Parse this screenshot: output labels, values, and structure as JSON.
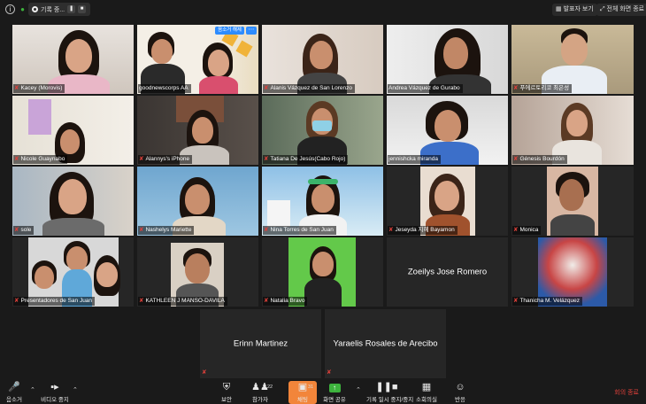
{
  "top_bar": {
    "recording_label": "기록 중...",
    "speaker_view_label": "발표자 보기",
    "fullscreen_exit_label": "전체 화면 종료"
  },
  "tiles": [
    {
      "name": "Kacey (Morovis)",
      "muted": true
    },
    {
      "name": "goodnewscorps AA",
      "muted": false,
      "unmute_label": "음소거 해제"
    },
    {
      "name": "Alanis Vázquez de San Lorenzo",
      "muted": true
    },
    {
      "name": "Andrea Vázquez de Gurabo",
      "muted": false
    },
    {
      "name": "푸에르토리코 최은성",
      "muted": true
    },
    {
      "name": "Nicole Guaynabo",
      "muted": true
    },
    {
      "name": "Alannys's iPhone",
      "muted": true
    },
    {
      "name": "Tatiana De Jesús(Cabo Rojo)",
      "muted": true
    },
    {
      "name": "jennishcka miranda",
      "muted": false
    },
    {
      "name": "Génesis Bourdón",
      "muted": true
    },
    {
      "name": "sole",
      "muted": true
    },
    {
      "name": "Nashelys Mariette",
      "muted": true
    },
    {
      "name": "Nina Torres de San Juan",
      "muted": true
    },
    {
      "name": "Jeseyda 지혜 Bayamon",
      "muted": true
    },
    {
      "name": "Monica",
      "muted": true
    },
    {
      "name": "Presentadores de San Juan",
      "muted": true
    },
    {
      "name": "KATHLEEN J MANSO-DAVILA",
      "muted": true
    },
    {
      "name": "Natalia Bravo",
      "muted": true
    },
    {
      "name": "Zoeilys Jose Romero",
      "muted": false,
      "video_off": true
    },
    {
      "name": "Thanicha M. Velázquez",
      "muted": true
    },
    {
      "name": "Erinn Martinez",
      "muted": true,
      "video_off": true
    },
    {
      "name": "Yaraelis Rosales de Arecibo",
      "muted": true,
      "video_off": true
    }
  ],
  "bottom_bar": {
    "mute": "음소거",
    "video_stop": "비디오 중지",
    "security": "보안",
    "participants": "참가자",
    "participants_count": "22",
    "chat": "채팅",
    "chat_count": "31",
    "share_screen": "화면 공유",
    "pause_stop_recording": "기록 일시 중지/중지",
    "breakout_rooms": "소회의실",
    "reactions": "반응",
    "end_meeting": "회의 종료"
  },
  "colors": {
    "background": "#1a1a1a",
    "accent_blue": "#2d8cff",
    "muted_red": "#e0403a",
    "chat_orange": "#f2853a",
    "share_green": "#3db33d",
    "active_speaker": "#8fd16a"
  }
}
